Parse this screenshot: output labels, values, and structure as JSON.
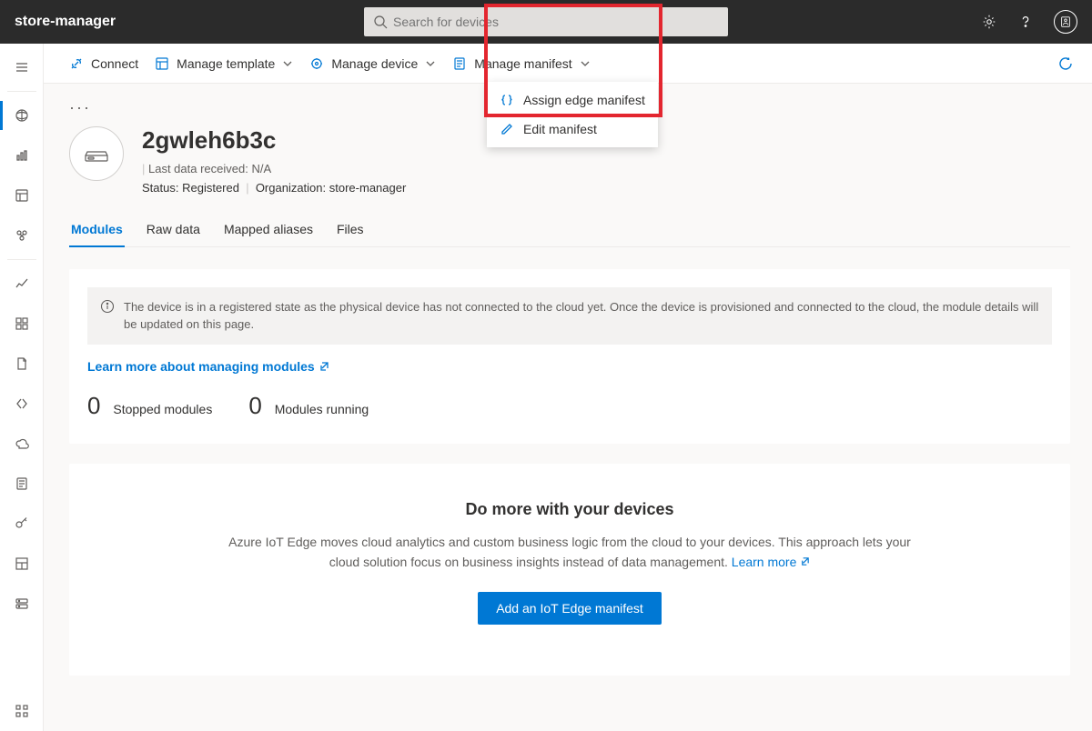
{
  "header": {
    "app_title": "store-manager",
    "search_placeholder": "Search for devices"
  },
  "commandbar": {
    "connect": "Connect",
    "manage_template": "Manage template",
    "manage_device": "Manage device",
    "manage_manifest": "Manage manifest",
    "dropdown": {
      "assign": "Assign edge manifest",
      "edit": "Edit manifest"
    }
  },
  "device": {
    "name": "2gwleh6b3c",
    "last_data_label": "Last data received:",
    "last_data_value": "N/A",
    "status_label": "Status:",
    "status_value": "Registered",
    "org_label": "Organization:",
    "org_value": "store-manager"
  },
  "tabs": {
    "modules": "Modules",
    "raw_data": "Raw data",
    "mapped_aliases": "Mapped aliases",
    "files": "Files"
  },
  "banner": "The device is in a registered state as the physical device has not connected to the cloud yet. Once the device is provisioned and connected to the cloud, the module details will be updated on this page.",
  "learn_modules": "Learn more about managing modules",
  "counts": {
    "stopped_num": "0",
    "stopped_label": "Stopped modules",
    "running_num": "0",
    "running_label": "Modules running"
  },
  "empty": {
    "title": "Do more with your devices",
    "body": "Azure IoT Edge moves cloud analytics and custom business logic from the cloud to your devices. This approach lets your cloud solution focus on business insights instead of data management.",
    "learn_more": "Learn more",
    "cta": "Add an IoT Edge manifest"
  }
}
